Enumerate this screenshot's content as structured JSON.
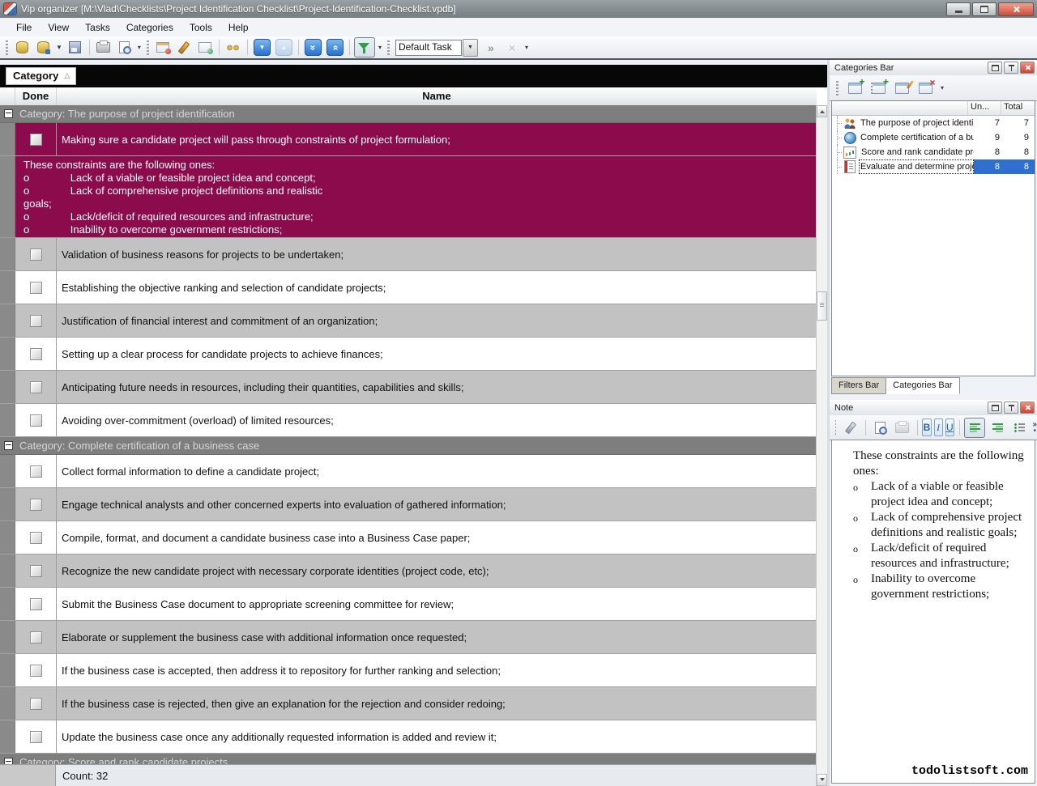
{
  "window": {
    "title": "Vip organizer [M:\\Vlad\\Checklists\\Project Identification Checklist\\Project-Identification-Checklist.vpdb]"
  },
  "menu": {
    "items": [
      "File",
      "View",
      "Tasks",
      "Categories",
      "Tools",
      "Help"
    ]
  },
  "toolbar": {
    "combo_value": "Default Task",
    "left_buttons": [
      {
        "t": "btn",
        "name": "new-database-button",
        "icon": "dbnew"
      },
      {
        "t": "btn",
        "name": "open-database-button",
        "icon": "dbopen"
      },
      {
        "t": "arrow",
        "name": "open-database-dropdown",
        "glyph": "▼"
      },
      {
        "t": "btn",
        "name": "save-button",
        "icon": "save"
      },
      {
        "t": "sep"
      },
      {
        "t": "btn",
        "name": "print-button",
        "icon": "print"
      },
      {
        "t": "btn",
        "name": "print-preview-button",
        "icon": "preview"
      },
      {
        "t": "arrow",
        "name": "print-preview-dropdown",
        "glyph": "▾"
      },
      {
        "t": "grip"
      },
      {
        "t": "btn",
        "name": "new-task-button",
        "icon": "tasknew"
      },
      {
        "t": "btn",
        "name": "edit-task-button",
        "icon": "taskedit"
      },
      {
        "t": "btn",
        "name": "delete-task-button",
        "icon": "taskdel"
      },
      {
        "t": "sep"
      },
      {
        "t": "btn",
        "name": "find-button",
        "icon": "find"
      },
      {
        "t": "sep"
      },
      {
        "t": "bluebtn",
        "name": "move-down-button",
        "glyph": "▼"
      },
      {
        "t": "bluebtn",
        "name": "move-up-button",
        "glyph": "▲",
        "cls": "pale"
      },
      {
        "t": "sep"
      },
      {
        "t": "bluebtn2",
        "name": "move-to-bottom-button",
        "glyph": "»",
        "cls": "dbl-down"
      },
      {
        "t": "bluebtn3",
        "name": "move-to-top-button",
        "glyph": "»",
        "cls": "dbl-up"
      },
      {
        "t": "sep"
      },
      {
        "t": "btn",
        "name": "filter-button",
        "icon": "filter",
        "cls": "pressed"
      },
      {
        "t": "arrow",
        "name": "filter-dropdown",
        "glyph": "▾"
      },
      {
        "t": "grip"
      }
    ],
    "right_buttons": [
      {
        "t": "btn",
        "name": "apply-filter-button",
        "icon": "apply"
      },
      {
        "t": "btn",
        "name": "clear-filter-button",
        "icon": "clear",
        "cls": "disabled"
      },
      {
        "t": "arrow",
        "name": "toolbar-overflow-dropdown",
        "glyph": "▾"
      }
    ]
  },
  "grid": {
    "group_by_label": "Category",
    "sort_indicator": "△",
    "columns": {
      "done": "Done",
      "name": "Name"
    },
    "footer_count": "Count: 32",
    "rows": [
      {
        "t": "cat",
        "text": "Category: The purpose of project identification"
      },
      {
        "t": "task",
        "cls": "sel",
        "text": "Making sure a candidate project will pass through constraints of project formulation;"
      },
      {
        "t": "note",
        "text": "These constraints are the following ones:\no              Lack of a viable or feasible project idea and concept;\no              Lack of comprehensive project definitions and realistic\ngoals;\no              Lack/deficit of required resources and infrastructure;\no              Inability to overcome government restrictions;"
      },
      {
        "t": "task",
        "cls": "gray",
        "text": "Validation of business reasons for projects to be undertaken;"
      },
      {
        "t": "task",
        "cls": "white",
        "text": "Establishing the objective ranking and selection of candidate projects;"
      },
      {
        "t": "task",
        "cls": "gray",
        "text": "Justification of financial interest and commitment of an organization;"
      },
      {
        "t": "task",
        "cls": "white",
        "text": "Setting up a clear process for candidate projects to achieve finances;"
      },
      {
        "t": "task",
        "cls": "gray",
        "text": "Anticipating future needs in resources, including their quantities, capabilities and skills;"
      },
      {
        "t": "task",
        "cls": "white",
        "text": "Avoiding over-commitment (overload) of limited resources;"
      },
      {
        "t": "cat",
        "text": "Category: Complete certification of a business case"
      },
      {
        "t": "task",
        "cls": "white",
        "text": "Collect formal information to define a candidate project;"
      },
      {
        "t": "task",
        "cls": "gray",
        "text": "Engage technical analysts and other concerned experts into evaluation of gathered information;"
      },
      {
        "t": "task",
        "cls": "white",
        "text": "Compile, format, and document a candidate business case into a Business Case paper;"
      },
      {
        "t": "task",
        "cls": "gray",
        "text": "Recognize the new candidate project with necessary corporate identities (project code, etc);"
      },
      {
        "t": "task",
        "cls": "white",
        "text": "Submit the Business Case document to appropriate screening committee for review;"
      },
      {
        "t": "task",
        "cls": "gray",
        "text": "Elaborate or supplement the business case with additional information once requested;"
      },
      {
        "t": "task",
        "cls": "white",
        "text": "If the business case is accepted, then address it to repository for further ranking and selection;"
      },
      {
        "t": "task",
        "cls": "gray",
        "text": "If the business case is rejected, then give an explanation for the rejection and consider redoing;"
      },
      {
        "t": "task",
        "cls": "white",
        "text": "Update the business case once any additionally requested information is added and review it;"
      },
      {
        "t": "cat",
        "text": "Category: Score and rank candidate projects"
      },
      {
        "t": "stub"
      }
    ]
  },
  "categories_panel": {
    "title": "Categories Bar",
    "toolbar_buttons": [
      {
        "t": "grip"
      },
      {
        "t": "btn",
        "name": "new-category-button",
        "icon": "catnew"
      },
      {
        "t": "btn",
        "name": "new-subcategory-button",
        "icon": "catsub"
      },
      {
        "t": "btn",
        "name": "edit-category-button",
        "icon": "catedit"
      },
      {
        "t": "btn",
        "name": "delete-category-button",
        "icon": "catdel"
      },
      {
        "t": "arrow",
        "name": "categories-toolbar-dropdown",
        "glyph": "▾"
      }
    ],
    "columns": {
      "unread": "Un...",
      "total": "Total"
    },
    "items": [
      {
        "icon": "people",
        "label": "The purpose of project identi",
        "un": "7",
        "total": "7"
      },
      {
        "icon": "globe",
        "label": "Complete certification of a bu",
        "un": "9",
        "total": "9"
      },
      {
        "icon": "chart",
        "label": "Score and rank candidate pro",
        "un": "8",
        "total": "8"
      },
      {
        "icon": "notes",
        "label": "Evaluate and determine proje",
        "un": "8",
        "total": "8",
        "cls": "selected"
      }
    ]
  },
  "tabs": {
    "filters": "Filters Bar",
    "categories": "Categories Bar"
  },
  "note_panel": {
    "title": "Note",
    "toolbar_buttons": [
      {
        "t": "grip"
      },
      {
        "t": "btn",
        "name": "edit-note-button",
        "icon": "pen"
      },
      {
        "t": "sep"
      },
      {
        "t": "btn",
        "name": "preview-note-button",
        "icon": "preview"
      },
      {
        "t": "btn",
        "name": "print-note-button",
        "icon": "print",
        "cls": "disabled"
      },
      {
        "t": "sep"
      },
      {
        "t": "fmt",
        "name": "bold-button",
        "glyph": "B",
        "cls": "b"
      },
      {
        "t": "fmt",
        "name": "italic-button",
        "glyph": "I",
        "cls": "i"
      },
      {
        "t": "fmt",
        "name": "underline-button",
        "glyph": "U",
        "cls": "u"
      },
      {
        "t": "sep"
      },
      {
        "t": "btn",
        "name": "align-left-button",
        "icon": "alignleft",
        "cls": "pressed"
      },
      {
        "t": "btn",
        "name": "align-right-button",
        "icon": "alignright"
      },
      {
        "t": "btn",
        "name": "bullet-list-button",
        "icon": "bullets"
      },
      {
        "t": "over",
        "name": "note-toolbar-overflow",
        "glyph": "»",
        "arrow": "▾"
      }
    ],
    "intro": "These constraints are the following ones:",
    "bullet_marker": "o",
    "bullets": [
      {
        "marker": "o",
        "text": "Lack of a viable or feasible project idea and concept;"
      },
      {
        "marker": "o",
        "text": "Lack of comprehensive project definitions and realistic goals;"
      },
      {
        "marker": "o",
        "text": "Lack/deficit of required resources and infrastructure;"
      },
      {
        "marker": "o",
        "text": "Inability to overcome government restrictions;"
      }
    ]
  },
  "watermark": "todolistsoft.com",
  "colors": {
    "selected_row_maroon": "#8C0B4D",
    "category_band_gray": "#7E7E7E",
    "row_alt_gray": "#C2C2C2",
    "selection_blue": "#2E6FD0",
    "close_button_red": "#CC4535",
    "groupby_band_black": "#070707"
  }
}
